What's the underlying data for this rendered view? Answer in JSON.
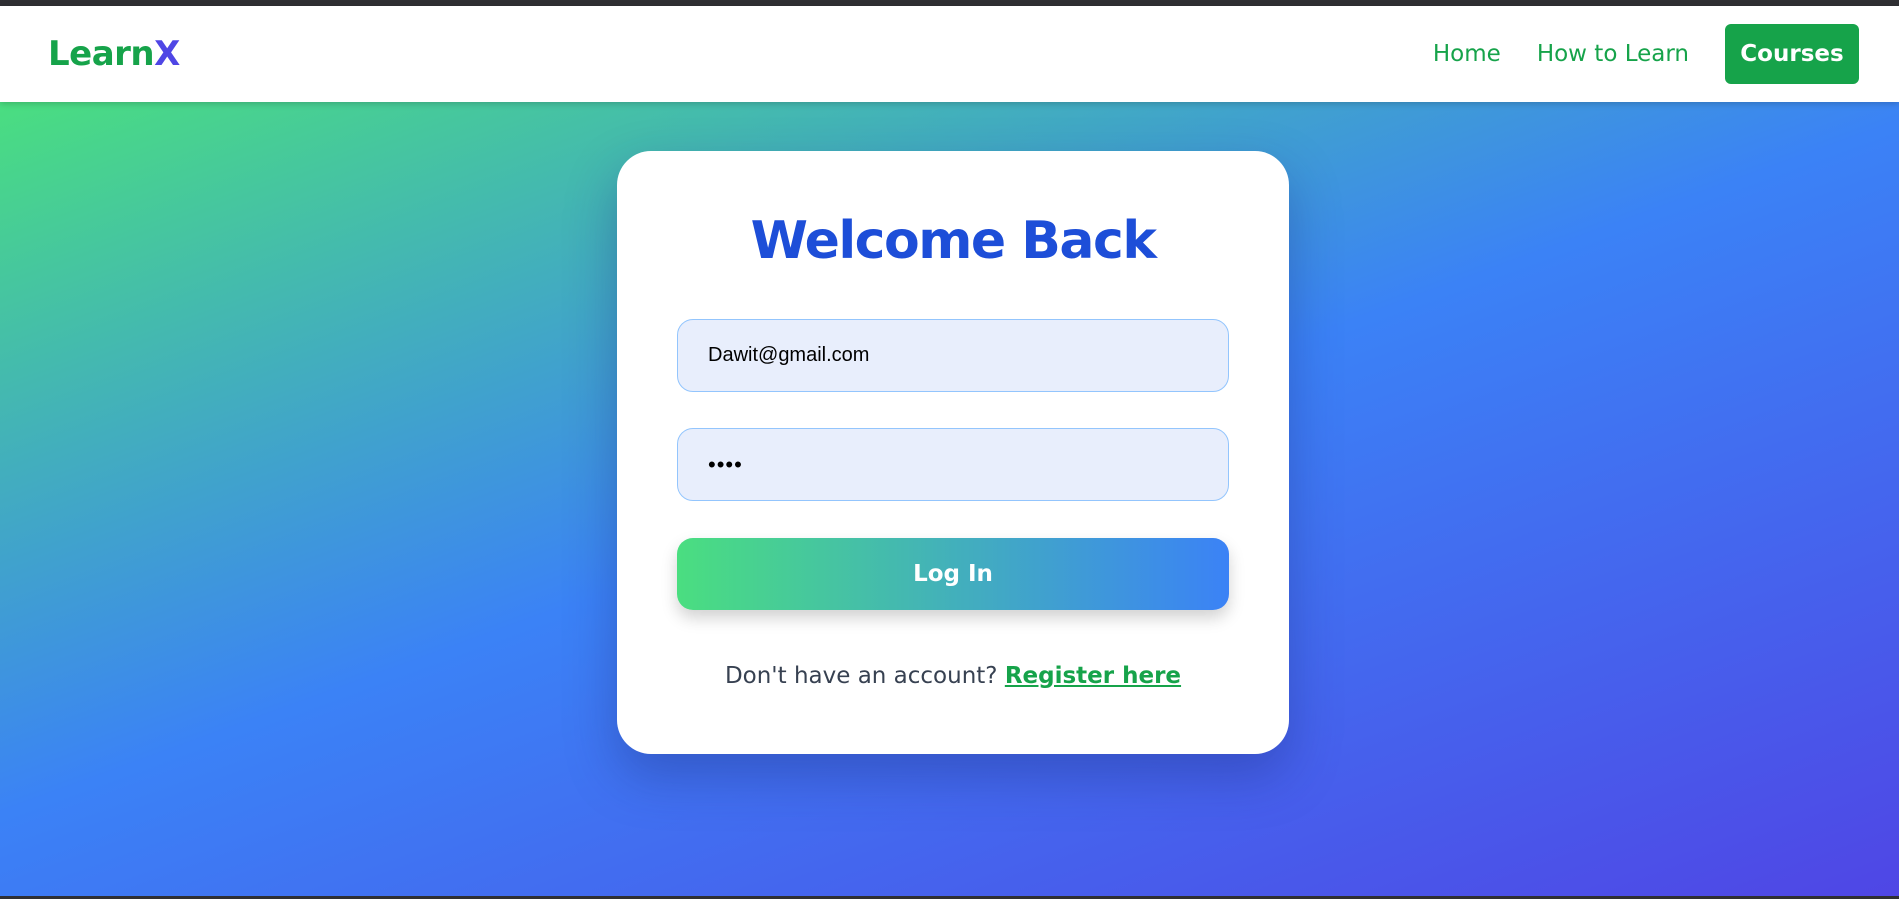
{
  "navbar": {
    "logo_main": "Learn",
    "logo_accent": "X",
    "links": [
      {
        "label": "Home"
      },
      {
        "label": "How to Learn"
      }
    ],
    "cta_label": "Courses"
  },
  "login_card": {
    "title": "Welcome Back",
    "email_value": "Dawit@gmail.com",
    "password_value": "••••",
    "submit_label": "Log In",
    "register_prompt": "Don't have an account?",
    "register_link": "Register here"
  },
  "colors": {
    "brand_green": "#16a34a",
    "brand_indigo": "#4f46e5",
    "title_blue": "#1d4ed8",
    "input_bg": "#e8eefc",
    "gradient_start": "#4ade80",
    "gradient_mid": "#3b82f6",
    "gradient_end": "#4f46e5"
  }
}
